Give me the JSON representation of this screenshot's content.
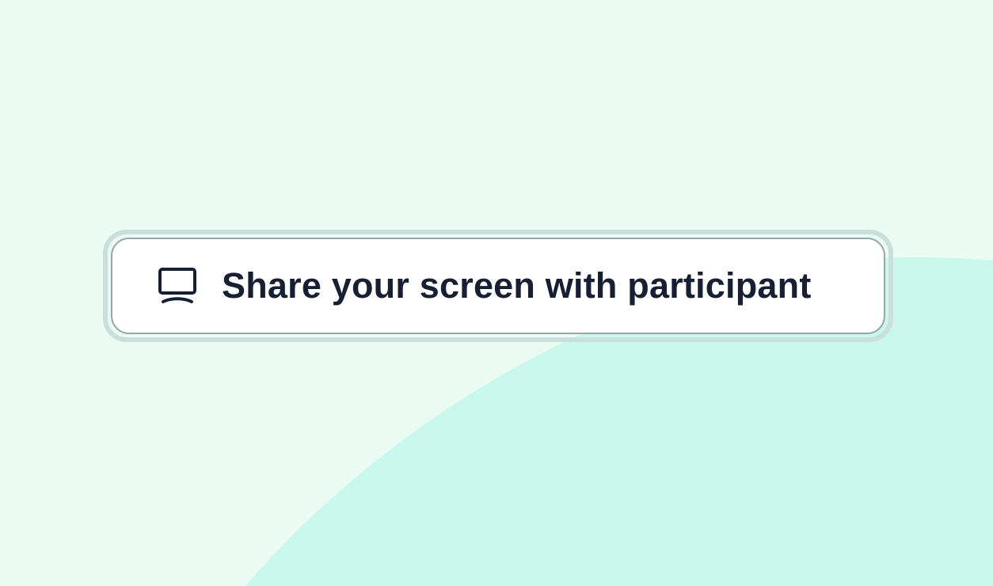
{
  "button": {
    "label": "Share your screen with participant",
    "icon": "monitor-icon"
  },
  "colors": {
    "background": "#e9fbf3",
    "accent_shape": "#c8f8eb",
    "text": "#172033",
    "button_bg": "#ffffff",
    "button_border": "#97a8aa",
    "outer_ring": "#cadfd9"
  }
}
